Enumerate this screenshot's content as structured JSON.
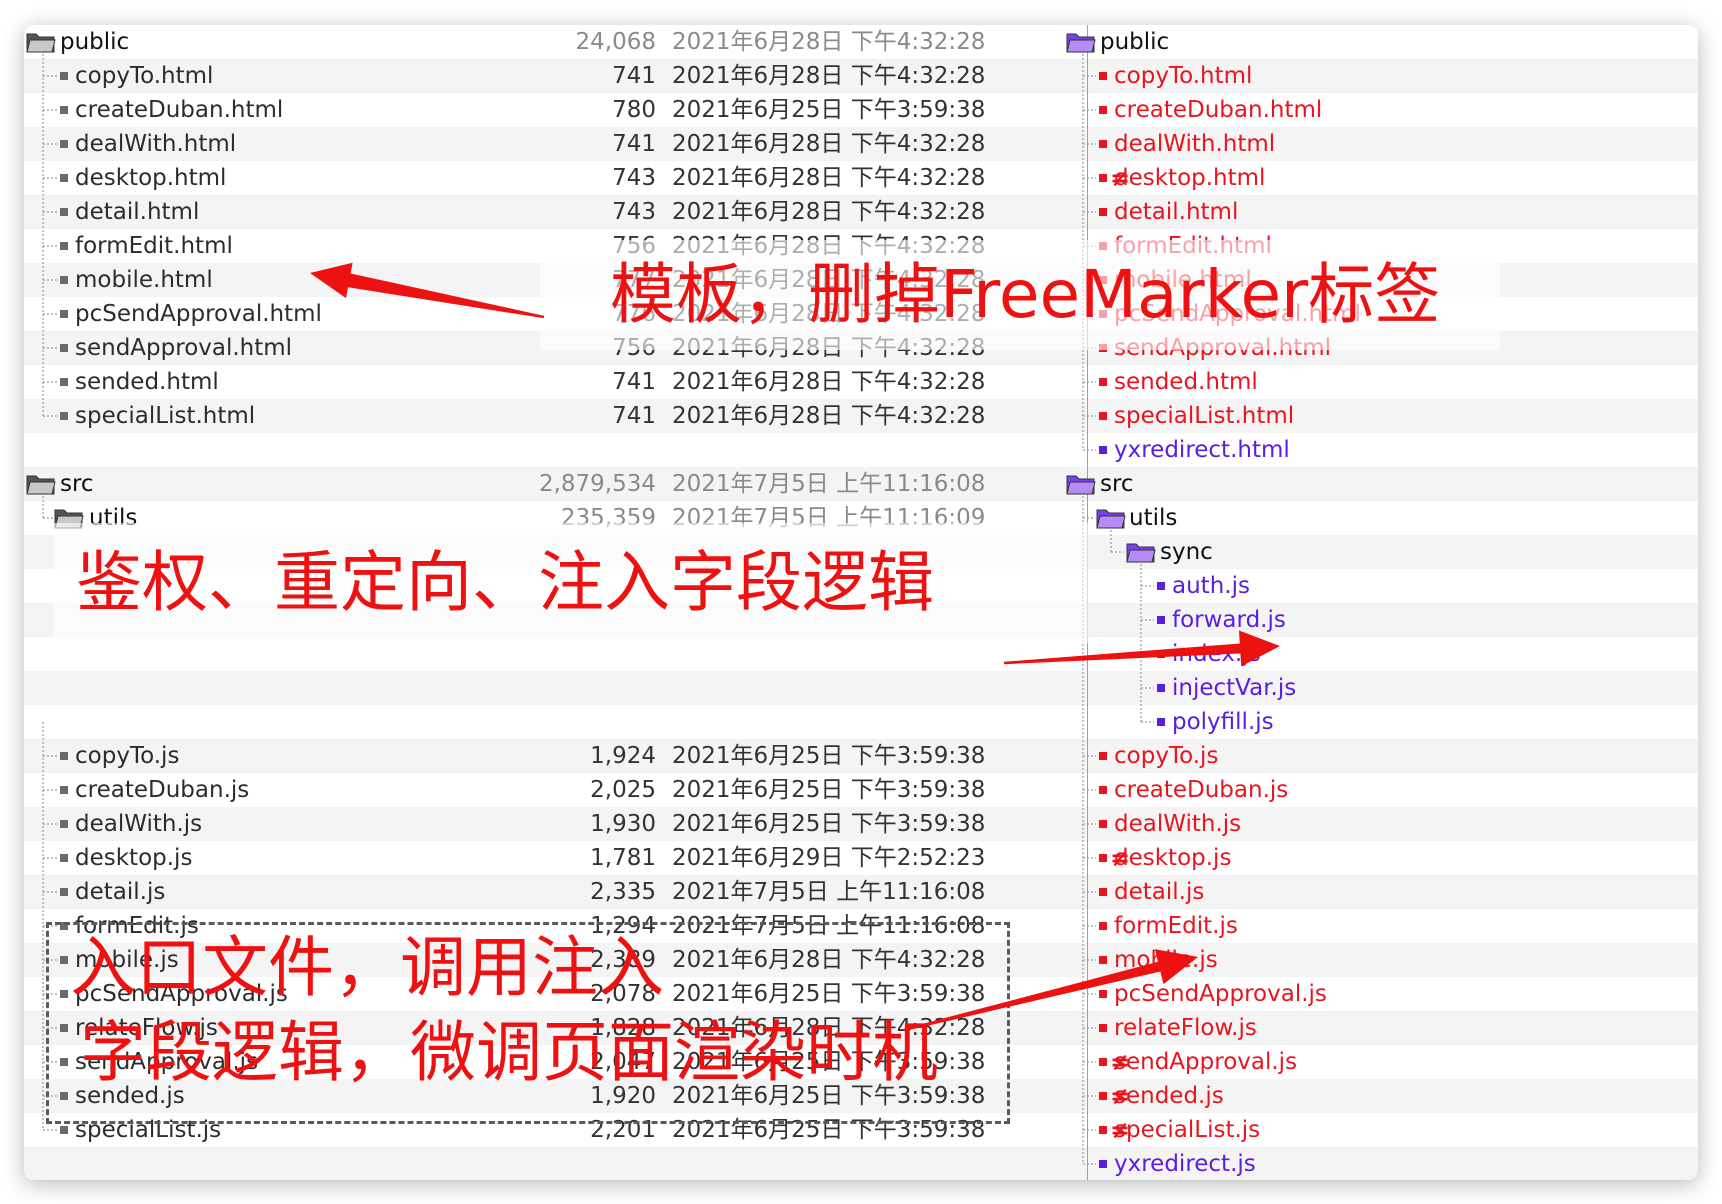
{
  "left": {
    "public": {
      "name": "public",
      "size": "24,068",
      "date": "2021年6月28日 下午4:32:28"
    },
    "public_files": [
      {
        "name": "copyTo.html",
        "size": "741",
        "date": "2021年6月28日 下午4:32:28"
      },
      {
        "name": "createDuban.html",
        "size": "780",
        "date": "2021年6月25日 下午3:59:38"
      },
      {
        "name": "dealWith.html",
        "size": "741",
        "date": "2021年6月28日 下午4:32:28"
      },
      {
        "name": "desktop.html",
        "size": "743",
        "date": "2021年6月28日 下午4:32:28"
      },
      {
        "name": "detail.html",
        "size": "743",
        "date": "2021年6月28日 下午4:32:28"
      },
      {
        "name": "formEdit.html",
        "size": "756",
        "date": "2021年6月28日 下午4:32:28"
      },
      {
        "name": "mobile.html",
        "size": "777",
        "date": "2021年6月28日 下午4:32:28"
      },
      {
        "name": "pcSendApproval.html",
        "size": "776",
        "date": "2021年6月28日 下午4:32:28"
      },
      {
        "name": "sendApproval.html",
        "size": "756",
        "date": "2021年6月28日 下午4:32:28"
      },
      {
        "name": "sended.html",
        "size": "741",
        "date": "2021年6月28日 下午4:32:28"
      },
      {
        "name": "specialList.html",
        "size": "741",
        "date": "2021年6月28日 下午4:32:28"
      }
    ],
    "src": {
      "name": "src",
      "size": "2,879,534",
      "date": "2021年7月5日 上午11:16:08"
    },
    "utils": {
      "name": "utils",
      "size": "235,359",
      "date": "2021年7月5日 上午11:16:09"
    },
    "src_files": [
      {
        "name": "copyTo.js",
        "size": "1,924",
        "date": "2021年6月25日 下午3:59:38"
      },
      {
        "name": "createDuban.js",
        "size": "2,025",
        "date": "2021年6月25日 下午3:59:38"
      },
      {
        "name": "dealWith.js",
        "size": "1,930",
        "date": "2021年6月25日 下午3:59:38"
      },
      {
        "name": "desktop.js",
        "size": "1,781",
        "date": "2021年6月29日 下午2:52:23"
      },
      {
        "name": "detail.js",
        "size": "2,335",
        "date": "2021年7月5日 上午11:16:08"
      },
      {
        "name": "formEdit.js",
        "size": "1,294",
        "date": "2021年7月5日 上午11:16:08"
      },
      {
        "name": "mobile.js",
        "size": "2,389",
        "date": "2021年6月28日 下午4:32:28"
      },
      {
        "name": "pcSendApproval.js",
        "size": "2,078",
        "date": "2021年6月25日 下午3:59:38"
      },
      {
        "name": "relateFlow.js",
        "size": "1,828",
        "date": "2021年6月28日 下午4:32:28"
      },
      {
        "name": "sendApproval.js",
        "size": "2,047",
        "date": "2021年6月25日 下午3:59:38"
      },
      {
        "name": "sended.js",
        "size": "1,920",
        "date": "2021年6月25日 下午3:59:38"
      },
      {
        "name": "specialList.js",
        "size": "2,201",
        "date": "2021年6月25日 下午3:59:38"
      }
    ]
  },
  "diff_marker": "≠",
  "right": {
    "public": "public",
    "public_files": [
      "copyTo.html",
      "createDuban.html",
      "dealWith.html",
      "desktop.html",
      "detail.html",
      "formEdit.html",
      "mobile.html",
      "pcSendApproval.html",
      "sendApproval.html",
      "sended.html",
      "specialList.html",
      "yxredirect.html"
    ],
    "src": "src",
    "utils": "utils",
    "sync": "sync",
    "sync_files": [
      "auth.js",
      "forward.js",
      "index.js",
      "injectVar.js",
      "polyfill.js"
    ],
    "src_files": [
      "copyTo.js",
      "createDuban.js",
      "dealWith.js",
      "desktop.js",
      "detail.js",
      "formEdit.js",
      "mobile.js",
      "pcSendApproval.js",
      "relateFlow.js",
      "sendApproval.js",
      "sended.js",
      "specialList.js",
      "yxredirect.js"
    ]
  },
  "annotations": {
    "a1": "模板，删掉FreeMarker标签",
    "a2": "鉴权、重定向、注入字段逻辑",
    "a3_line1": "入口文件，调用注入",
    "a3_line2": "字段逻辑，微调页面渲染时机"
  },
  "colors": {
    "changed": "#e8141e",
    "added": "#5a1ee0",
    "annotation": "#ee1111",
    "folder_gray": "#555555",
    "folder_purple": "#7b3ff0"
  }
}
